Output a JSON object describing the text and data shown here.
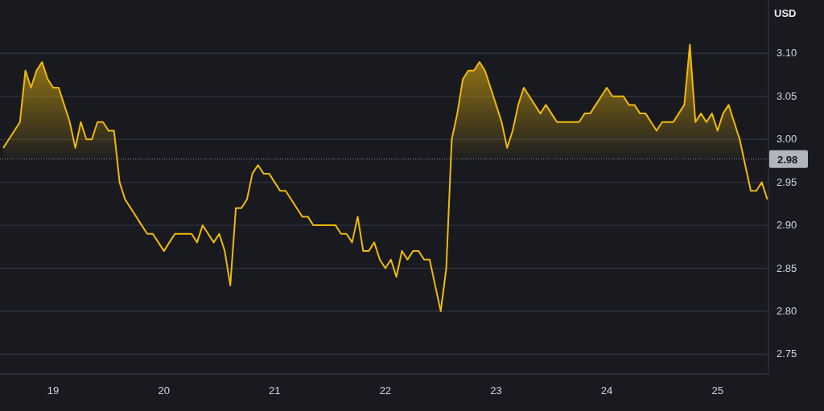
{
  "chart_data": {
    "type": "area",
    "ylabel": "USD",
    "xlim": [
      18.52,
      25.46
    ],
    "ylim": [
      2.727,
      3.162
    ],
    "xticks": [
      {
        "value": 19,
        "label": "19"
      },
      {
        "value": 20,
        "label": "20"
      },
      {
        "value": 21,
        "label": "21"
      },
      {
        "value": 22,
        "label": "22"
      },
      {
        "value": 23,
        "label": "23"
      },
      {
        "value": 24,
        "label": "24"
      },
      {
        "value": 25,
        "label": "25"
      }
    ],
    "yticks": [
      {
        "value": 2.75,
        "label": "2.75"
      },
      {
        "value": 2.8,
        "label": "2.80"
      },
      {
        "value": 2.85,
        "label": "2.85"
      },
      {
        "value": 2.9,
        "label": "2.90"
      },
      {
        "value": 2.95,
        "label": "2.95"
      },
      {
        "value": 3.0,
        "label": "3.00"
      },
      {
        "value": 3.05,
        "label": "3.05"
      },
      {
        "value": 3.1,
        "label": "3.10"
      }
    ],
    "x": [
      18.55,
      18.6,
      18.65,
      18.7,
      18.75,
      18.8,
      18.85,
      18.9,
      18.95,
      19.0,
      19.05,
      19.1,
      19.15,
      19.2,
      19.25,
      19.3,
      19.35,
      19.4,
      19.45,
      19.5,
      19.55,
      19.6,
      19.65,
      19.7,
      19.75,
      19.8,
      19.85,
      19.9,
      19.95,
      20.0,
      20.05,
      20.1,
      20.15,
      20.2,
      20.25,
      20.3,
      20.35,
      20.4,
      20.45,
      20.5,
      20.55,
      20.6,
      20.65,
      20.7,
      20.75,
      20.8,
      20.85,
      20.9,
      20.95,
      21.0,
      21.05,
      21.1,
      21.15,
      21.2,
      21.25,
      21.3,
      21.35,
      21.4,
      21.45,
      21.5,
      21.55,
      21.6,
      21.65,
      21.7,
      21.75,
      21.8,
      21.85,
      21.9,
      21.95,
      22.0,
      22.05,
      22.1,
      22.15,
      22.2,
      22.25,
      22.3,
      22.35,
      22.4,
      22.45,
      22.5,
      22.55,
      22.6,
      22.65,
      22.7,
      22.75,
      22.8,
      22.85,
      22.9,
      22.95,
      23.0,
      23.05,
      23.1,
      23.15,
      23.2,
      23.25,
      23.3,
      23.35,
      23.4,
      23.45,
      23.5,
      23.55,
      23.6,
      23.65,
      23.7,
      23.75,
      23.8,
      23.85,
      23.9,
      23.95,
      24.0,
      24.05,
      24.1,
      24.15,
      24.2,
      24.25,
      24.3,
      24.35,
      24.4,
      24.45,
      24.5,
      24.55,
      24.6,
      24.65,
      24.7,
      24.75,
      24.8,
      24.85,
      24.9,
      24.95,
      25.0,
      25.05,
      25.1,
      25.15,
      25.2,
      25.25,
      25.3,
      25.35,
      25.4,
      25.45
    ],
    "grid": true,
    "series": [
      {
        "color": "#f0b90b",
        "values": [
          2.99,
          3.0,
          3.01,
          3.02,
          3.08,
          3.06,
          3.08,
          3.09,
          3.07,
          3.06,
          3.06,
          3.04,
          3.02,
          2.99,
          3.02,
          3.0,
          3.0,
          3.02,
          3.02,
          3.01,
          3.01,
          2.95,
          2.93,
          2.92,
          2.91,
          2.9,
          2.89,
          2.89,
          2.88,
          2.87,
          2.88,
          2.89,
          2.89,
          2.89,
          2.89,
          2.88,
          2.9,
          2.89,
          2.88,
          2.89,
          2.87,
          2.83,
          2.92,
          2.92,
          2.93,
          2.96,
          2.97,
          2.96,
          2.96,
          2.95,
          2.94,
          2.94,
          2.93,
          2.92,
          2.91,
          2.91,
          2.9,
          2.9,
          2.9,
          2.9,
          2.9,
          2.89,
          2.89,
          2.88,
          2.91,
          2.87,
          2.87,
          2.88,
          2.86,
          2.85,
          2.86,
          2.84,
          2.87,
          2.86,
          2.87,
          2.87,
          2.86,
          2.86,
          2.83,
          2.8,
          2.85,
          3.0,
          3.03,
          3.07,
          3.08,
          3.08,
          3.09,
          3.08,
          3.06,
          3.04,
          3.02,
          2.99,
          3.01,
          3.04,
          3.06,
          3.05,
          3.04,
          3.03,
          3.04,
          3.03,
          3.02,
          3.02,
          3.02,
          3.02,
          3.02,
          3.03,
          3.03,
          3.04,
          3.05,
          3.06,
          3.05,
          3.05,
          3.05,
          3.04,
          3.04,
          3.03,
          3.03,
          3.02,
          3.01,
          3.02,
          3.02,
          3.02,
          3.03,
          3.04,
          3.11,
          3.02,
          3.03,
          3.02,
          3.03,
          3.01,
          3.03,
          3.04,
          3.02,
          3.0,
          2.97,
          2.94,
          2.94,
          2.95,
          2.93
        ]
      }
    ],
    "ref_lines": [
      {
        "axis": "y",
        "value": 2.977,
        "label": "2.98"
      }
    ]
  }
}
